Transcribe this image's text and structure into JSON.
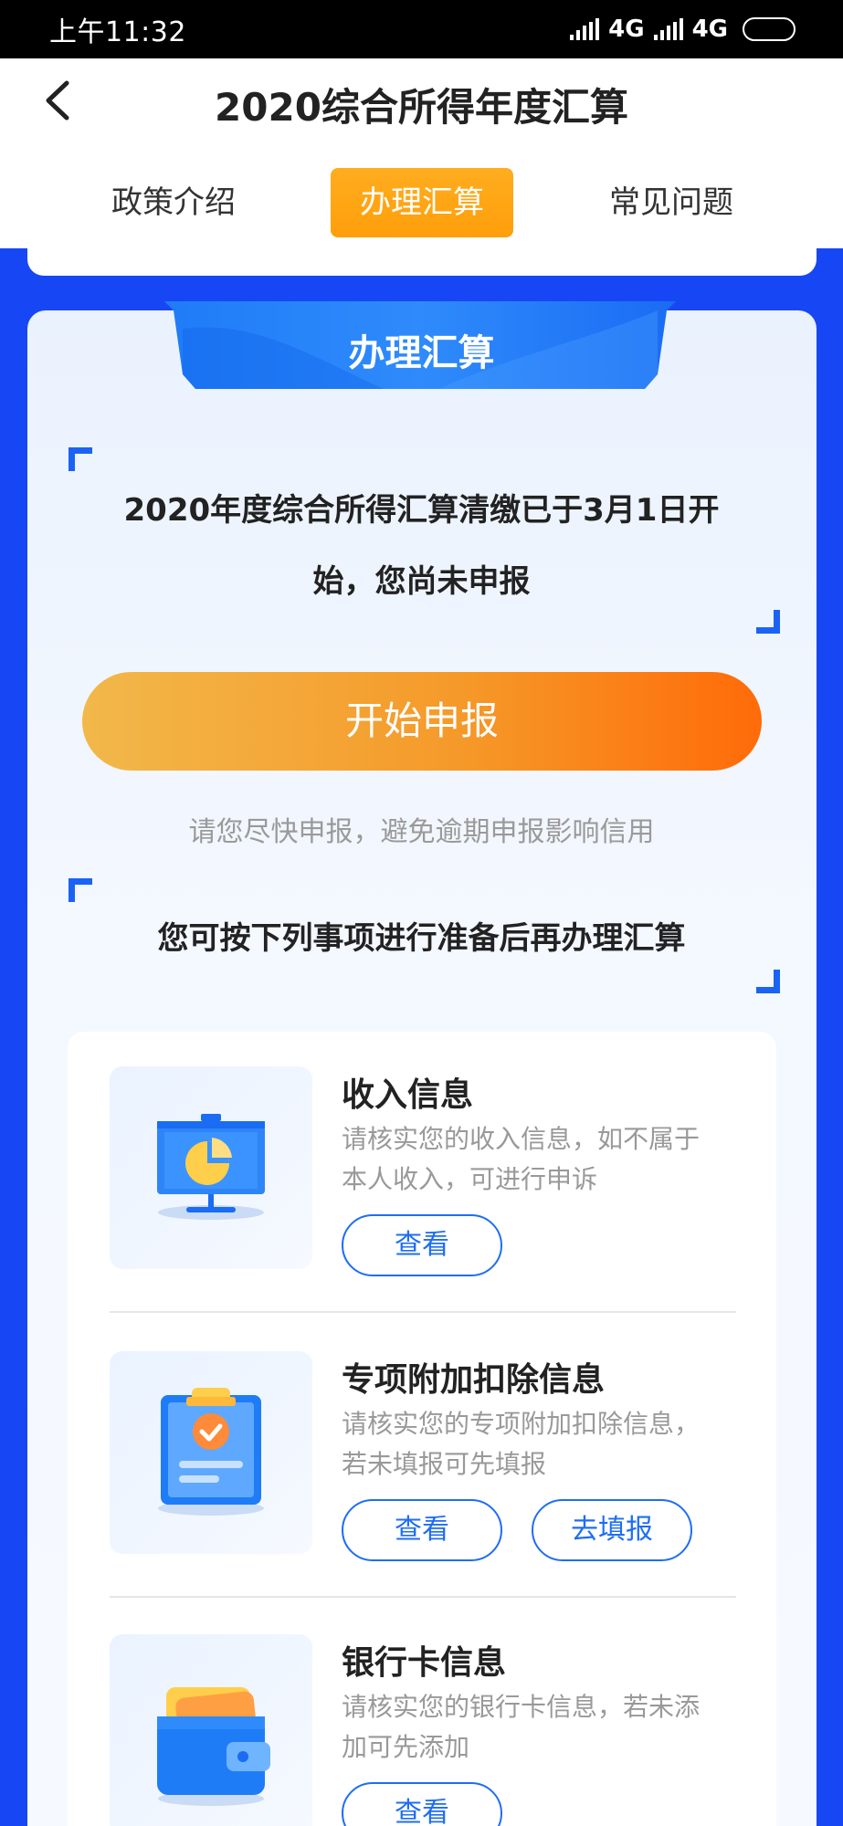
{
  "status_bar": {
    "time": "上午11:32",
    "network_1": "4G",
    "network_2": "4G",
    "battery": "43"
  },
  "header": {
    "title": "2020综合所得年度汇算",
    "tabs": [
      {
        "label": "政策介绍",
        "active": false
      },
      {
        "label": "办理汇算",
        "active": true
      },
      {
        "label": "常见问题",
        "active": false
      }
    ]
  },
  "main": {
    "banner": "办理汇算",
    "notice_line1": "2020年度综合所得汇算清缴已于3月1日开",
    "notice_line2": "始，您尚未申报",
    "start_button": "开始申报",
    "hint": "请您尽快申报，避免逾期申报影响信用",
    "prep_title": "您可按下列事项进行准备后再办理汇算"
  },
  "items": [
    {
      "title": "收入信息",
      "desc_line1": "请核实您的收入信息，如不属于",
      "desc_line2": "本人收入，可进行申诉",
      "buttons": [
        "查看"
      ],
      "icon": "presentation-chart-icon"
    },
    {
      "title": "专项附加扣除信息",
      "desc_line1": "请核实您的专项附加扣除信息，",
      "desc_line2": "若未填报可先填报",
      "buttons": [
        "查看",
        "去填报"
      ],
      "icon": "clipboard-check-icon"
    },
    {
      "title": "银行卡信息",
      "desc_line1": "请核实您的银行卡信息，若未添",
      "desc_line2": "加可先添加",
      "buttons": [
        "查看"
      ],
      "icon": "wallet-card-icon"
    }
  ],
  "colors": {
    "page_bg": "#1747f5",
    "accent_blue": "#1f6df5",
    "tab_active": "#ffa514",
    "start_gradient_from": "#f2b84a",
    "start_gradient_to": "#ff6b08"
  }
}
